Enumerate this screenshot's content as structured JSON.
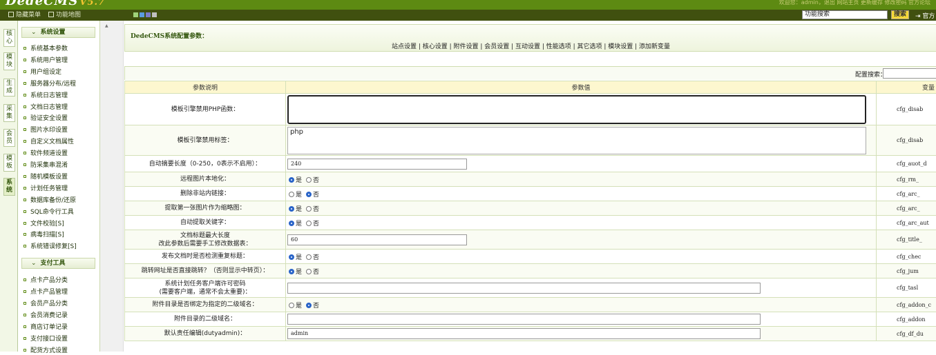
{
  "app": {
    "logo": "DedeCMS",
    "version": "V5.7",
    "top_links": "欢迎您：admin，退出 网站主页 更新缓存 修改密码 官方论坛"
  },
  "toolbar": {
    "hide_menu": "隐藏菜单",
    "func_map": "功能地图",
    "colors": [
      "#9fd27a",
      "#5b9be0",
      "#7c7cc8",
      "#c0c0c0"
    ],
    "search_value": "功能搜索",
    "search_btn": "搜索",
    "official": "官方"
  },
  "vtabs": [
    "核心",
    "模块",
    "生成",
    "采集",
    "会员",
    "模板",
    "系统"
  ],
  "sidebar": {
    "groups": [
      {
        "title": "系统设置",
        "items": [
          "系统基本参数",
          "系统用户管理",
          "用户组设定",
          "服务器分布/远程",
          "系统日志管理",
          "文档日志管理",
          "验证安全设置",
          "图片水印设置",
          "自定义文档属性",
          "软件频道设置",
          "防采集串混淆",
          "随机模板设置",
          "计划任务管理",
          "数据库备份/还原",
          "SQL命令行工具",
          "文件校验[S]",
          "病毒扫描[S]",
          "系统错误修复[S]"
        ]
      },
      {
        "title": "支付工具",
        "items": [
          "点卡产品分类",
          "点卡产品管理",
          "会员产品分类",
          "会员消费记录",
          "商店订单记录",
          "支付接口设置",
          "配货方式设置"
        ]
      }
    ]
  },
  "main": {
    "title": "DedeCMS系统配置参数：",
    "tabs": "站点设置 | 核心设置 | 附件设置 | 会员设置 | 互动设置 | 性能选项 | 其它选项 | 模块设置 | 添加新变量",
    "search_label": "配置搜索：",
    "headers": [
      "参数说明",
      "参数值",
      "变量"
    ],
    "radio_yes": "是",
    "radio_no": "否",
    "rows": [
      {
        "label": "模板引擎禁用PHP函数：",
        "type": "textarea",
        "value": "",
        "var": "cfg_disab",
        "focus": true
      },
      {
        "label": "模板引擎禁用标签：",
        "type": "textarea",
        "value": "php",
        "var": "cfg_disab"
      },
      {
        "label": "自动摘要长度（0-250，0表示不启用）：",
        "type": "text",
        "value": "240",
        "var": "cfg_auot_d",
        "w": 260
      },
      {
        "label": "远程图片本地化：",
        "type": "radio",
        "value": "yes",
        "var": "cfg_rm_"
      },
      {
        "label": "删除非站内链接：",
        "type": "radio",
        "value": "no",
        "var": "cfg_arc_"
      },
      {
        "label": "提取第一张图片作为缩略图：",
        "type": "radio",
        "value": "yes",
        "var": "cfg_arc_"
      },
      {
        "label": "自动提取关键字：",
        "type": "radio",
        "value": "yes",
        "var": "cfg_arc_aut"
      },
      {
        "label": "文档标题最大长度",
        "label2": "改此参数后需要手工修改数据表：",
        "type": "text",
        "value": "60",
        "var": "cfg_title_",
        "w": 260
      },
      {
        "label": "发布文档时是否检测重复标题：",
        "type": "radio",
        "value": "yes",
        "var": "cfg_chec"
      },
      {
        "label": "跳转网址是否直接跳转？（否则显示中转页）：",
        "type": "radio",
        "value": "yes",
        "var": "cfg_jum"
      },
      {
        "label": "系统计划任务客户端许可密码",
        "label2": "(需要客户端，通常不会太重要)：",
        "type": "text",
        "value": "",
        "var": "cfg_tasl",
        "w": 685
      },
      {
        "label": "附件目录是否绑定为指定的二级域名：",
        "type": "radio",
        "value": "no",
        "var": "cfg_addon_c"
      },
      {
        "label": "附件目录的二级域名：",
        "type": "text",
        "value": "",
        "var": "cfg_addon",
        "w": 685
      },
      {
        "label": "默认责任编辑(dutyadmin)：",
        "type": "text",
        "value": "admin",
        "var": "cfg_df_du",
        "w": 685
      }
    ]
  }
}
